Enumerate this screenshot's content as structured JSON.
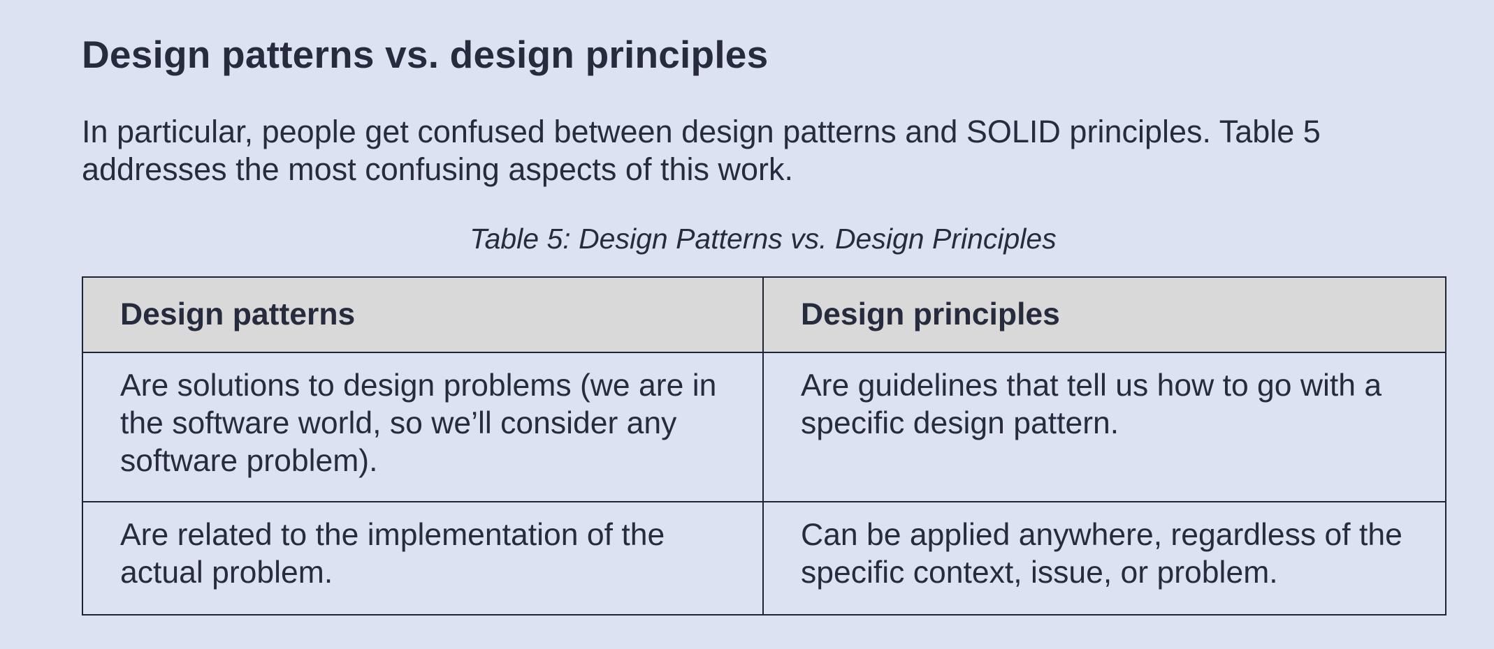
{
  "section": {
    "heading": "Design patterns vs. design principles",
    "intro": "In particular, people get confused between design patterns and SOLID principles. Table 5 addresses the most confusing aspects of this work."
  },
  "table": {
    "caption": "Table 5: Design Patterns vs. Design Principles",
    "headers": [
      "Design patterns",
      "Design principles"
    ],
    "rows": [
      [
        "Are solutions to design problems (we are in the software world, so we’ll consider any software problem).",
        "Are guidelines that tell us how to go with a specific design pattern."
      ],
      [
        "Are related to the implementation of the actual problem.",
        "Can be applied anywhere, regardless of the specific context, issue, or problem."
      ]
    ]
  },
  "colors": {
    "page_background": "#dce2f2",
    "text": "#262b3d",
    "header_background": "#d9d9d9",
    "border": "#1f2435"
  }
}
